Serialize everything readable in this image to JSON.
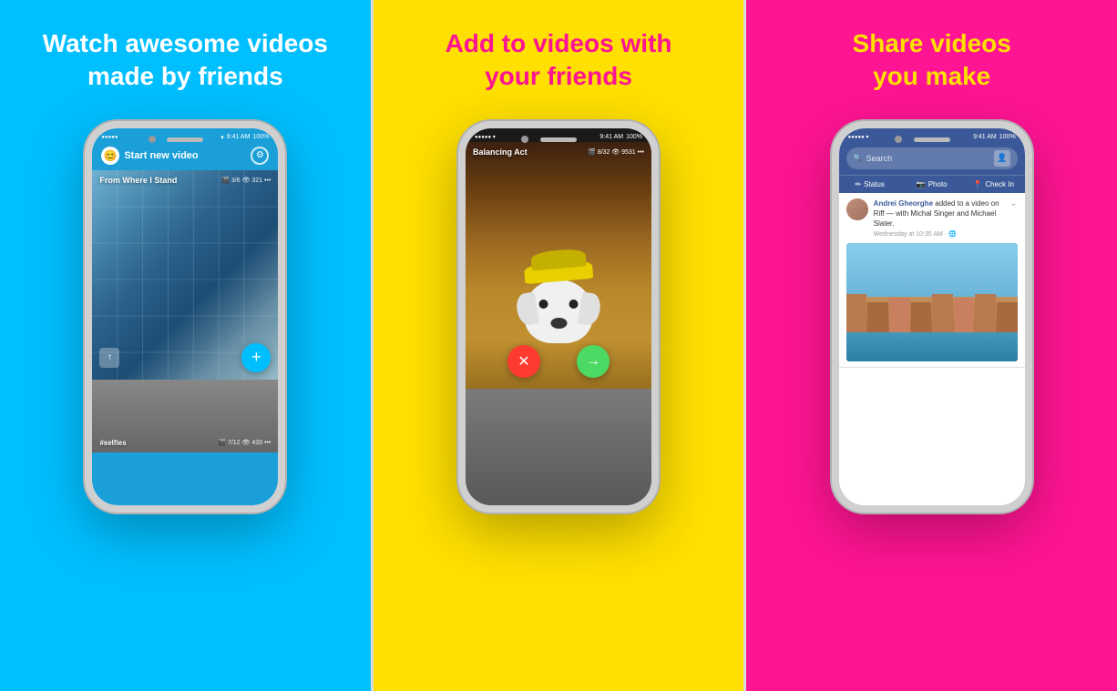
{
  "panel1": {
    "title_line1": "Watch awesome videos",
    "title_line2": "made by friends",
    "bg_color": "#00BFFF",
    "title_color": "#ffffff",
    "phone": {
      "status": {
        "time": "9:41 AM",
        "battery": "100%",
        "signal": "●●●●●"
      },
      "toolbar": {
        "start_label": "Start new video"
      },
      "feed": [
        {
          "title": "From Where I Stand",
          "meta": "🎬 3/6  👁 321  •••",
          "type": "building"
        },
        {
          "title": "#selfies",
          "meta": "🎬 7/12  👁 433  •••",
          "type": "person"
        }
      ]
    }
  },
  "panel2": {
    "title_line1": "Add to videos with",
    "title_line2": "your friends",
    "bg_color": "#FFE000",
    "title_color": "#FF1493",
    "phone": {
      "status": {
        "time": "9:41 AM",
        "battery": "100%"
      },
      "video": {
        "title": "Balancing Act",
        "meta": "🎬 8/32  👁 9531  •••"
      }
    }
  },
  "panel3": {
    "title_line1": "Share videos",
    "title_line2": "you make",
    "bg_color": "#FF1493",
    "title_color": "#FFE000",
    "phone": {
      "status": {
        "time": "9:41 AM",
        "battery": "100%"
      },
      "search": {
        "placeholder": "Search"
      },
      "nav": {
        "items": [
          "Status",
          "Photo",
          "Check In"
        ]
      },
      "post": {
        "author": "Andrei Gheorghe",
        "text": "Andrei Gheorghe added to a video on Riff — with Michal Singer and Michael Slater.",
        "time": "Wednesday at 10:35 AM · 🌐"
      }
    }
  }
}
